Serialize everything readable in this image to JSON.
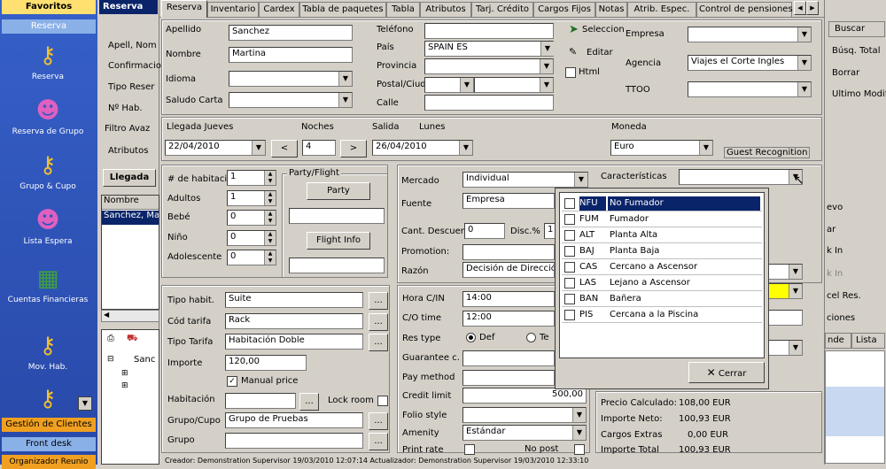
{
  "sidebar": {
    "favoritos": "Favoritos",
    "reserva_header": "Reserva",
    "items": [
      {
        "label": "Reserva"
      },
      {
        "label": "Reserva de Grupo"
      },
      {
        "label": "Grupo & Cupo"
      },
      {
        "label": "Lista Espera"
      },
      {
        "label": "Cuentas Financieras"
      },
      {
        "label": "Mov. Hab."
      },
      {
        "label": ""
      }
    ],
    "gestion": "Gestión de Clientes",
    "frontdesk": "Front desk",
    "organizador": "Organizador Reunio"
  },
  "leftpanel": {
    "header": "Reserva",
    "fields": [
      "Apell, Nom",
      "Confirmacio",
      "Tipo Reser",
      "Nº Hab.",
      "Filtro Avaz",
      "Atributos"
    ],
    "llegada_btn": "Llegada",
    "col_nombre": "Nombre",
    "row_name": "Sanchez, Ma",
    "tree_root": "Sanc"
  },
  "tabs": [
    "Reserva",
    "Inventario",
    "Cardex",
    "Tabla de paquetes",
    "Tabla",
    "Atributos",
    "Tarj. Crédito",
    "Cargos Fijos",
    "Notas",
    "Atrib. Espec.",
    "Control de pensiones"
  ],
  "guest": {
    "apellido_lbl": "Apellido",
    "apellido": "Sanchez",
    "nombre_lbl": "Nombre",
    "nombre": "Martina",
    "idioma_lbl": "Idioma",
    "saludo_lbl": "Saludo Carta",
    "telefono_lbl": "Teléfono",
    "pais_lbl": "País",
    "pais": "SPAIN   ES",
    "provincia_lbl": "Provincia",
    "postal_lbl": "Postal/Ciud",
    "calle_lbl": "Calle",
    "seleccion": "Seleccion",
    "editar": "Editar",
    "html": "Html",
    "empresa_lbl": "Empresa",
    "agencia_lbl": "Agencia",
    "agencia": "Viajes el Corte Ingles",
    "ttoo_lbl": "TTOO"
  },
  "stay": {
    "llegada_lbl": "Llegada Jueves",
    "noches_lbl": "Noches",
    "salida_lbl": "Salida",
    "salida_day": "Lunes",
    "moneda_lbl": "Moneda",
    "llegada": "22/04/2010",
    "noches": "4",
    "salida": "26/04/2010",
    "moneda": "Euro",
    "prev": "<",
    "next": ">",
    "guest_recog": "Guest Recognition"
  },
  "pax": {
    "habit_lbl": "# de habitacio",
    "habit": "1",
    "adultos_lbl": "Adultos",
    "adultos": "1",
    "bebe_lbl": "Bebé",
    "bebe": "0",
    "nino_lbl": "Niño",
    "nino": "0",
    "adol_lbl": "Adolescente",
    "adol": "0",
    "party_group": "Party/Flight",
    "party_btn": "Party",
    "flight_btn": "Flight Info"
  },
  "mercado": {
    "mercado_lbl": "Mercado",
    "mercado": "Individual",
    "fuente_lbl": "Fuente",
    "fuente": "Empresa",
    "caract_lbl": "Características",
    "cant_lbl": "Cant. Descuen",
    "cant": "0",
    "disc_lbl": "Disc.%",
    "disc": "1",
    "promo_lbl": "Promotion:",
    "razon_lbl": "Razón",
    "razon": "Decisión de Dirección"
  },
  "room": {
    "tipo_lbl": "Tipo habit.",
    "tipo": "Suite",
    "cod_lbl": "Cód tarifa",
    "cod": "Rack",
    "tipotar_lbl": "Tipo Tarifa",
    "tipotar": "Habitación Doble",
    "importe_lbl": "Importe",
    "importe": "120,00",
    "manual": "Manual price",
    "hab_lbl": "Habitación",
    "lock": "Lock room",
    "grupo_lbl": "Grupo/Cupo",
    "grupo": "Grupo de Pruebas",
    "grupo2_lbl": "Grupo",
    "dots": "..."
  },
  "times": {
    "horain_lbl": "Hora C/IN",
    "horain": "14:00",
    "horaout_lbl": "C/O time",
    "horaout": "12:00",
    "restype_lbl": "Res type",
    "def": "Def",
    "ter": "Te",
    "garant_lbl": "Guarantee c.",
    "pay_lbl": "Pay method",
    "credit_lbl": "Credit limit",
    "credit": "500,00",
    "folio_lbl": "Folio style",
    "amenity_lbl": "Amenity",
    "amenity": "Estándar",
    "print_lbl": "Print rate",
    "nopost": "No post"
  },
  "prices": {
    "calc_lbl": "Precio Calculado:",
    "calc": "108,00 EUR",
    "neto_lbl": "Importe Neto:",
    "neto": "100,93 EUR",
    "extra_lbl": "Cargos Extras",
    "extra": "0,00 EUR",
    "total_lbl": "Importe Total",
    "total": "100,93 EUR"
  },
  "popup": {
    "rows": [
      {
        "code": "NFU",
        "desc": "No Fumador"
      },
      {
        "code": "FUM",
        "desc": "Fumador"
      },
      {
        "code": "ALT",
        "desc": "Planta Alta"
      },
      {
        "code": "BAJ",
        "desc": "Planta Baja"
      },
      {
        "code": "CAS",
        "desc": "Cercano a Ascensor"
      },
      {
        "code": "LAS",
        "desc": "Lejano a Ascensor"
      },
      {
        "code": "BAN",
        "desc": "Bañera"
      },
      {
        "code": "PIS",
        "desc": "Cercana a la Piscina"
      }
    ],
    "cerrar": "Cerrar"
  },
  "rightpanel": {
    "buttons": [
      "Buscar",
      "Búsq. Total",
      "Borrar",
      "Ultimo Modif."
    ],
    "partial": [
      "evo",
      "ar",
      "k In",
      "k In",
      "cel Res.",
      "ciones"
    ],
    "tabs": [
      "nde",
      "Lista"
    ]
  },
  "status": {
    "text": "Creador: Demonstration Supervisor 19/03/2010 12:07:14   Actualizador: Demonstration Supervisor 19/03/2010 12:33:10"
  }
}
